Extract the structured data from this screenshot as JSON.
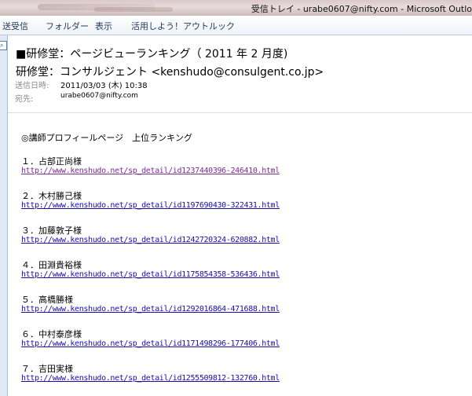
{
  "window": {
    "title": "受信トレイ - urabe0607@nifty.com - Microsoft Outlo"
  },
  "ribbon": {
    "tabs": [
      "送受信",
      "フォルダー",
      "表示",
      "活用しよう！アウトルック"
    ]
  },
  "message": {
    "subject": "■研修堂：ページビューランキング（ 2011 年 2 月度)",
    "sender": "研修堂：コンサルジェント <kenshudo@consulgent.co.jp>",
    "sent_label": "送信日時:",
    "sent_value": "2011/03/03 (木) 10:38",
    "to_label": "宛先:",
    "to_value": "urabe0607@nifty.com"
  },
  "body": {
    "heading": "◎講師プロフィールページ　上位ランキング",
    "entries": [
      {
        "rank": "１．占部正尚様",
        "url": "http://www.kenshudo.net/sp_detail/id1237440396-246410.html"
      },
      {
        "rank": "２．木村勝己様",
        "url": "http://www.kenshudo.net/sp_detail/id1197690430-322431.html"
      },
      {
        "rank": "３．加藤敦子様",
        "url": "http://www.kenshudo.net/sp_detail/id1242720324-620882.html"
      },
      {
        "rank": "４．田淵貴裕様",
        "url": "http://www.kenshudo.net/sp_detail/id1175854358-536436.html"
      },
      {
        "rank": "５．高橋勝様",
        "url": "http://www.kenshudo.net/sp_detail/id1292016864-471688.html"
      },
      {
        "rank": "６．中村泰彦様",
        "url": "http://www.kenshudo.net/sp_detail/id1171498296-177406.html"
      },
      {
        "rank": "７．吉田実様",
        "url": "http://www.kenshudo.net/sp_detail/id1255509812-132760.html"
      }
    ]
  },
  "icons": {
    "left_strip_icon": "search-icon"
  }
}
